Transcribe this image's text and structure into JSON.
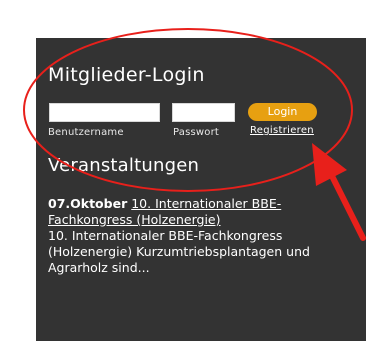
{
  "login": {
    "title": "Mitglieder-Login",
    "username_label": "Benutzername",
    "password_label": "Passwort",
    "login_button": "Login",
    "register_link": "Registrieren",
    "username_value": "",
    "password_value": ""
  },
  "events": {
    "title": "Veranstaltungen",
    "items": [
      {
        "date": "07.Oktober",
        "link": "10. Internationaler BBE-Fachkongress (Holzenergie)",
        "description": "10. Internationaler BBE-Fachkongress (Holzenergie) Kurzumtriebsplantagen und Agrarholz sind..."
      }
    ]
  },
  "colors": {
    "panel": "#333333",
    "button": "#e7a011",
    "annotation": "#e8201b"
  }
}
